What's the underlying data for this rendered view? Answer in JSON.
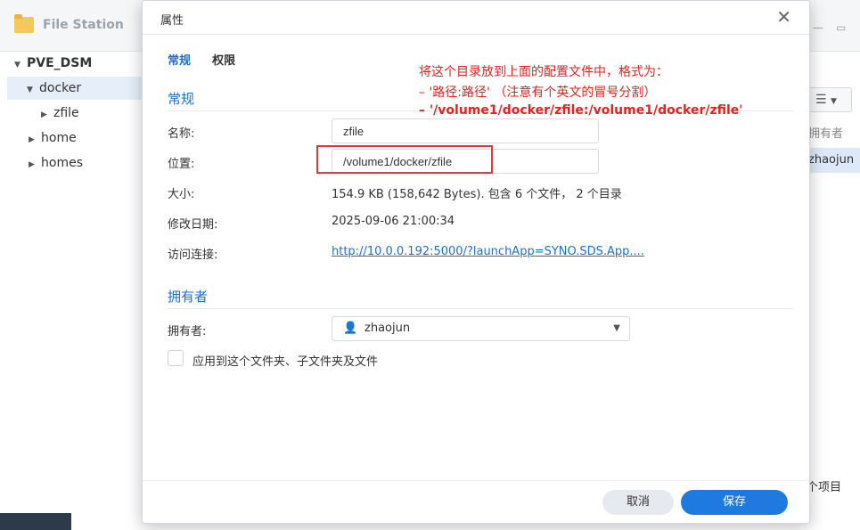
{
  "background": {
    "app_title": "File Station",
    "tree": {
      "root": "PVE_DSM",
      "items": [
        "docker",
        "zfile",
        "home",
        "homes"
      ]
    },
    "column_header": "拥有者",
    "row_owner": "zhaojun",
    "footer_text": "个项目"
  },
  "dialog": {
    "title": "属性",
    "tabs": [
      "常规",
      "权限"
    ],
    "general_section": "常规",
    "fields": {
      "name_label": "名称:",
      "name_value": "zfile",
      "location_label": "位置:",
      "location_value": "/volume1/docker/zfile",
      "size_label": "大小:",
      "size_value": "154.9 KB (158,642 Bytes). 包含 6 个文件， 2 个目录",
      "modified_label": "修改日期:",
      "modified_value": "2025-09-06 21:00:34",
      "link_label": "访问连接:",
      "link_value": "http://10.0.0.192:5000/?launchApp=SYNO.SDS.App...."
    },
    "owner_section": "拥有者",
    "owner_label": "拥有者:",
    "owner_value": "zhaojun",
    "apply_checkbox_label": "应用到这个文件夹、子文件夹及文件",
    "cancel_label": "取消",
    "save_label": "保存"
  },
  "annotation": {
    "line1": "将这个目录放到上面的配置文件中，格式为：",
    "line2": "– '路径:路径'   （注意有个英文的冒号分割）",
    "line3": "– '/volume1/docker/zfile:/volume1/docker/zfile'",
    "color": "#e82020"
  },
  "colors": {
    "accent": "#1f6fd1",
    "save_button": "#1f7ae0"
  }
}
